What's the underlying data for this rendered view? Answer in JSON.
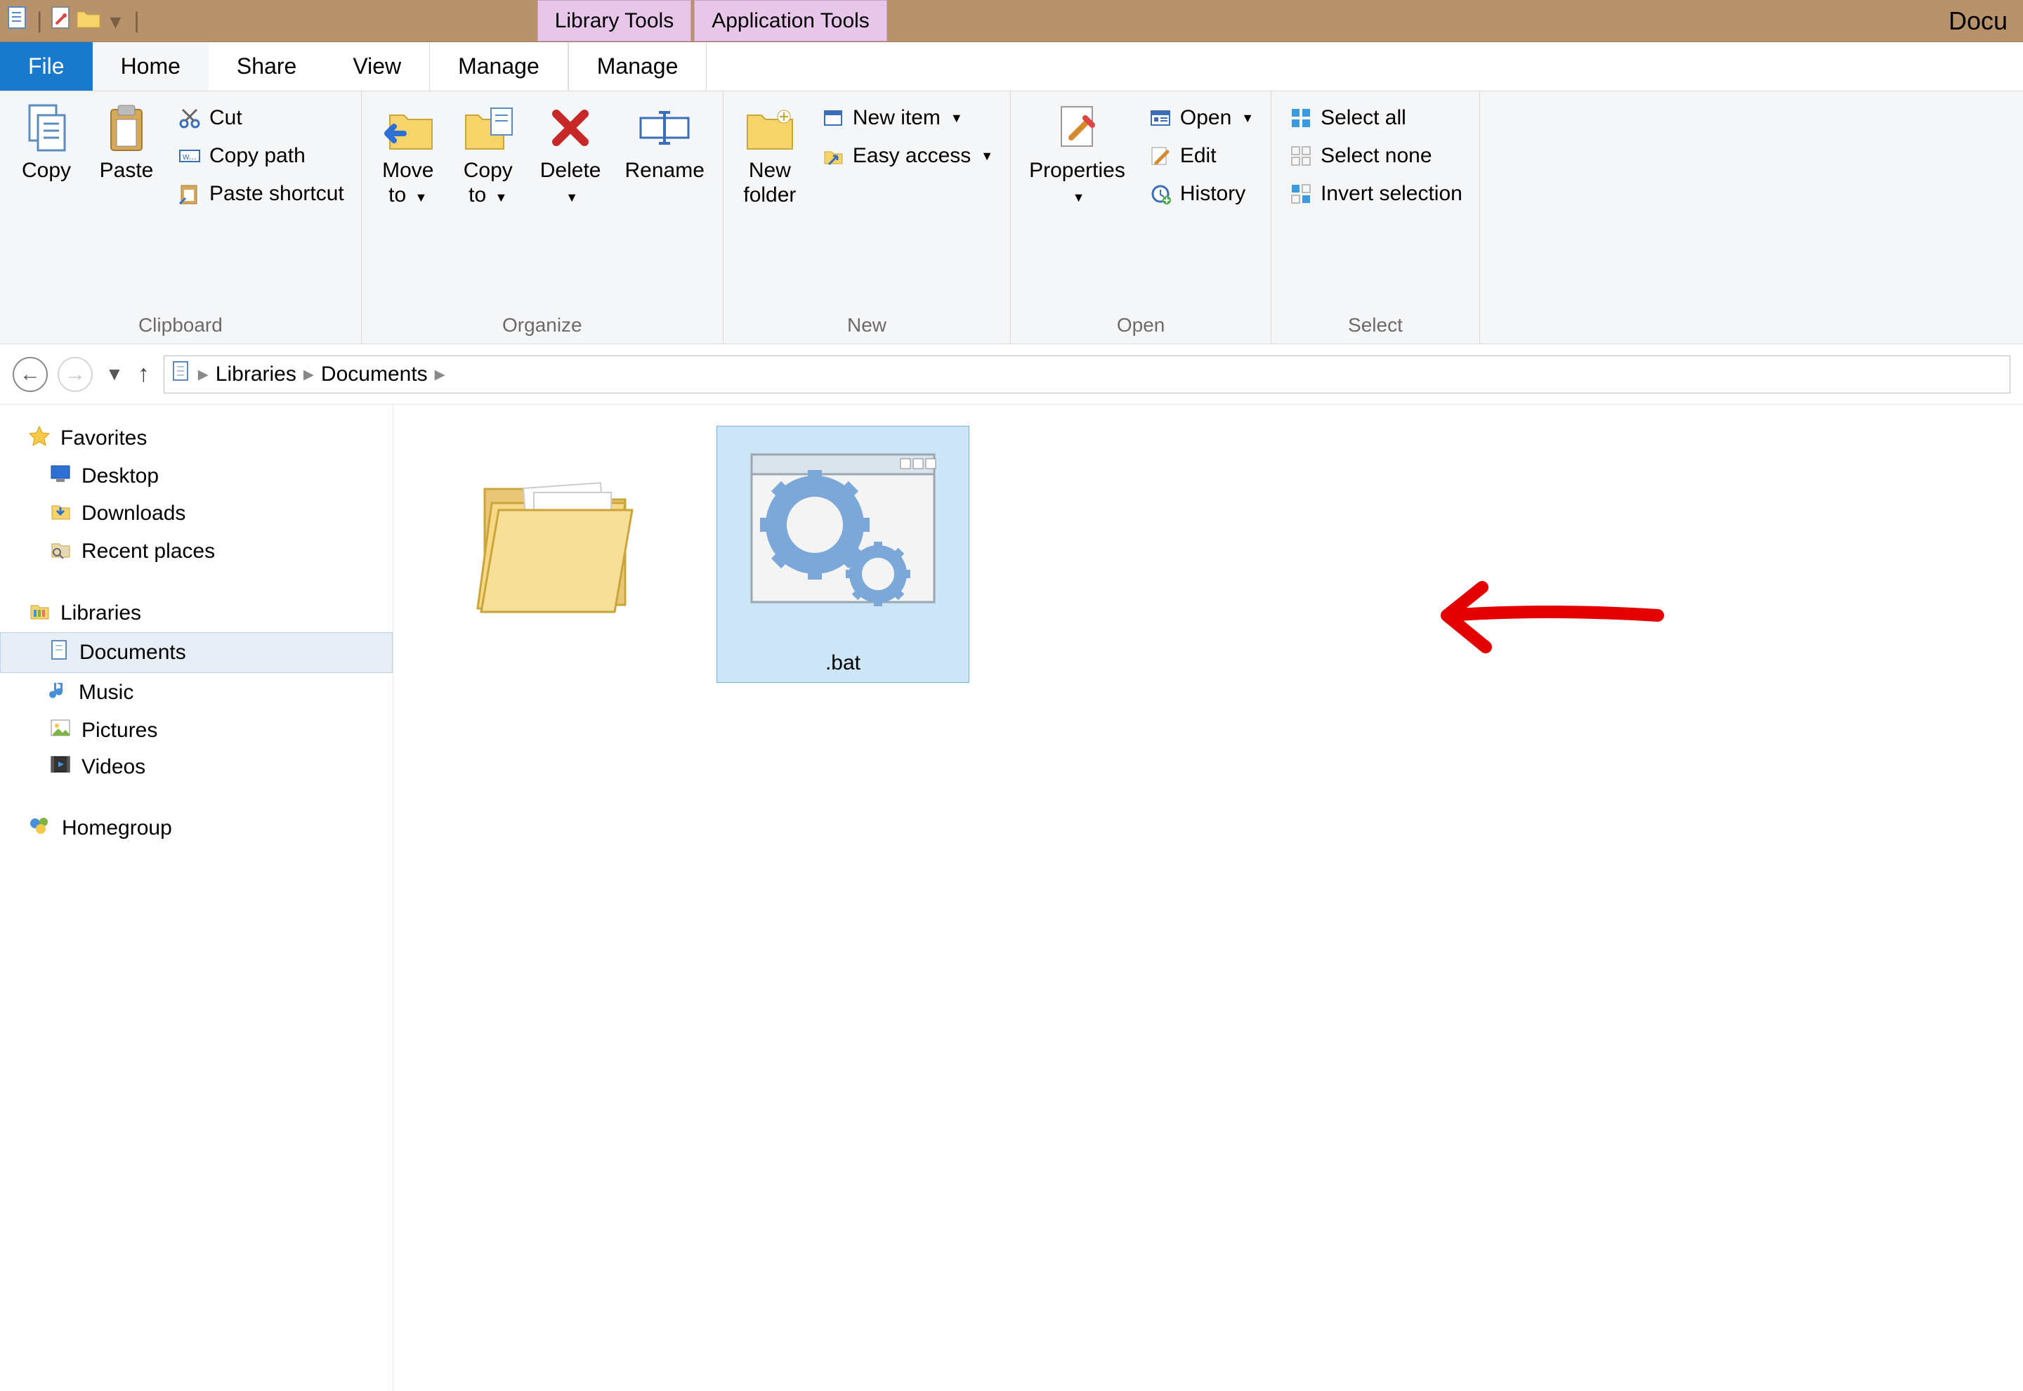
{
  "titlebar": {
    "context_tabs": [
      "Library Tools",
      "Application Tools"
    ],
    "window_title": "Docu"
  },
  "tabs": {
    "file": "File",
    "home": "Home",
    "share": "Share",
    "view": "View",
    "manage1": "Manage",
    "manage2": "Manage"
  },
  "ribbon": {
    "clipboard": {
      "label": "Clipboard",
      "copy": "Copy",
      "paste": "Paste",
      "cut": "Cut",
      "copy_path": "Copy path",
      "paste_shortcut": "Paste shortcut"
    },
    "organize": {
      "label": "Organize",
      "move_to": "Move\nto",
      "copy_to": "Copy\nto",
      "delete": "Delete",
      "rename": "Rename"
    },
    "new": {
      "label": "New",
      "new_folder": "New\nfolder",
      "new_item": "New item",
      "easy_access": "Easy access"
    },
    "open": {
      "label": "Open",
      "properties": "Properties",
      "open": "Open",
      "edit": "Edit",
      "history": "History"
    },
    "select": {
      "label": "Select",
      "select_all": "Select all",
      "select_none": "Select none",
      "invert": "Invert selection"
    }
  },
  "address": {
    "crumbs": [
      "Libraries",
      "Documents"
    ]
  },
  "nav": {
    "favorites": "Favorites",
    "desktop": "Desktop",
    "downloads": "Downloads",
    "recent": "Recent places",
    "libraries": "Libraries",
    "documents": "Documents",
    "music": "Music",
    "pictures": "Pictures",
    "videos": "Videos",
    "homegroup": "Homegroup"
  },
  "files": {
    "folder_name": "",
    "bat_name": ".bat"
  }
}
